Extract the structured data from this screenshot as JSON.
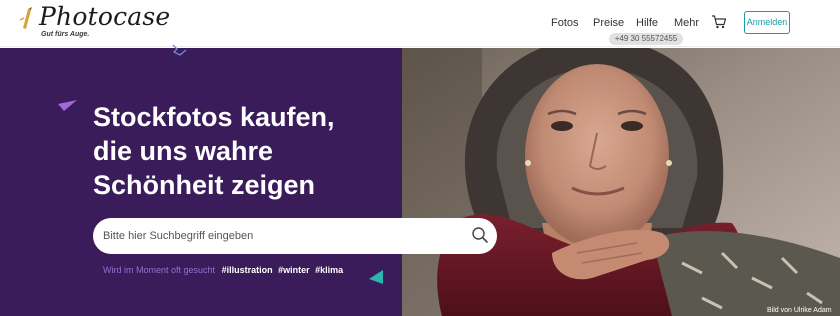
{
  "logo": {
    "name": "Photocase",
    "tagline": "Gut fürs Auge."
  },
  "nav": {
    "fotos": "Fotos",
    "preise": "Preise",
    "hilfe": "Hilfe",
    "mehr": "Mehr"
  },
  "header": {
    "login_label": "Anmelden",
    "phone": "+49 30 55572455"
  },
  "hero": {
    "headline": [
      "Stockfotos kaufen,",
      "die uns wahre",
      "Schönheit zeigen"
    ],
    "search": {
      "placeholder": "Bitte hier Suchbegriff eingeben"
    },
    "trending_label": "Wird im Moment oft gesucht",
    "trending_tags": [
      "#illustration",
      "#winter",
      "#klima"
    ],
    "photo_credit": "Bild von Ulrike Adam"
  },
  "colors": {
    "hero_background": "#3a1c5a",
    "accent": "#1a9ba6",
    "trending_label": "#9b6fcf"
  },
  "icons": [
    "pencil-logo-icon",
    "cart-icon",
    "search-icon"
  ]
}
